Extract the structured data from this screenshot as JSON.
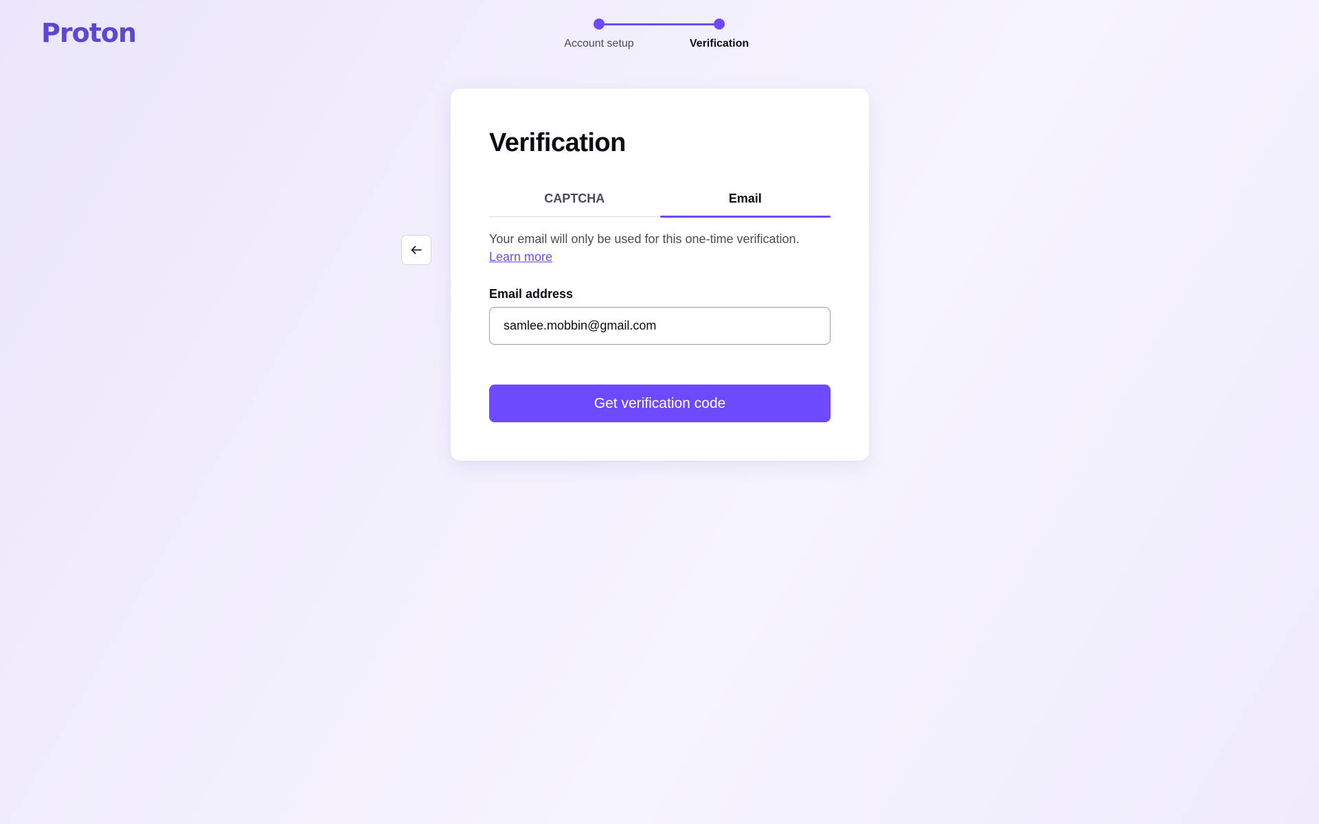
{
  "brand": {
    "logo_text": "Proton",
    "color": "#5b46d6"
  },
  "stepper": {
    "steps": [
      {
        "label": "Account setup",
        "state": "completed"
      },
      {
        "label": "Verification",
        "state": "active"
      }
    ]
  },
  "back_button": {
    "icon": "arrow-left-icon"
  },
  "card": {
    "title": "Verification",
    "tabs": [
      {
        "label": "CAPTCHA",
        "active": false
      },
      {
        "label": "Email",
        "active": true
      }
    ],
    "description": "Your email will only be used for this one-time verification.",
    "learn_more": "Learn more",
    "email_label": "Email address",
    "email_value": "samlee.mobbin@gmail.com",
    "submit_label": "Get verification code"
  },
  "colors": {
    "accent": "#6d4aff",
    "text": "#0c0c14",
    "muted": "#4a4a58"
  }
}
